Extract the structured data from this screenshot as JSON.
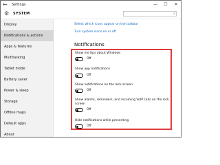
{
  "window": {
    "title": "Settings",
    "back": "←",
    "minimize": "—",
    "maximize": "☐",
    "close": "✕"
  },
  "header": {
    "section": "SYSTEM",
    "search_placeholder": ""
  },
  "sidebar": {
    "items": [
      {
        "label": "Display"
      },
      {
        "label": "Notifications & actions"
      },
      {
        "label": "Apps & features"
      },
      {
        "label": "Multitasking"
      },
      {
        "label": "Tablet mode"
      },
      {
        "label": "Battery saver"
      },
      {
        "label": "Power & sleep"
      },
      {
        "label": "Storage"
      },
      {
        "label": "Offline maps"
      },
      {
        "label": "Default apps"
      },
      {
        "label": "About"
      }
    ]
  },
  "content": {
    "links": [
      {
        "label": "Select which icons appear on the taskbar"
      },
      {
        "label": "Turn system icons on or off"
      }
    ],
    "heading": "Notifications",
    "settings": [
      {
        "label": "Show me tips about Windows",
        "state": "Off"
      },
      {
        "label": "Show app notifications",
        "state": "Off"
      },
      {
        "label": "Show notifications on the lock screen",
        "state": "Off"
      },
      {
        "label": "Show alarms, reminders, and incoming VoIP calls on the lock screen",
        "state": "Off"
      },
      {
        "label": "Hide notifications while presenting",
        "state": "Off"
      }
    ]
  },
  "colors": {
    "accent": "#0b66c3",
    "highlight": "#e23b3b",
    "sidebar_bg": "#f2f2f2",
    "active_bg": "#d6d6d6"
  }
}
